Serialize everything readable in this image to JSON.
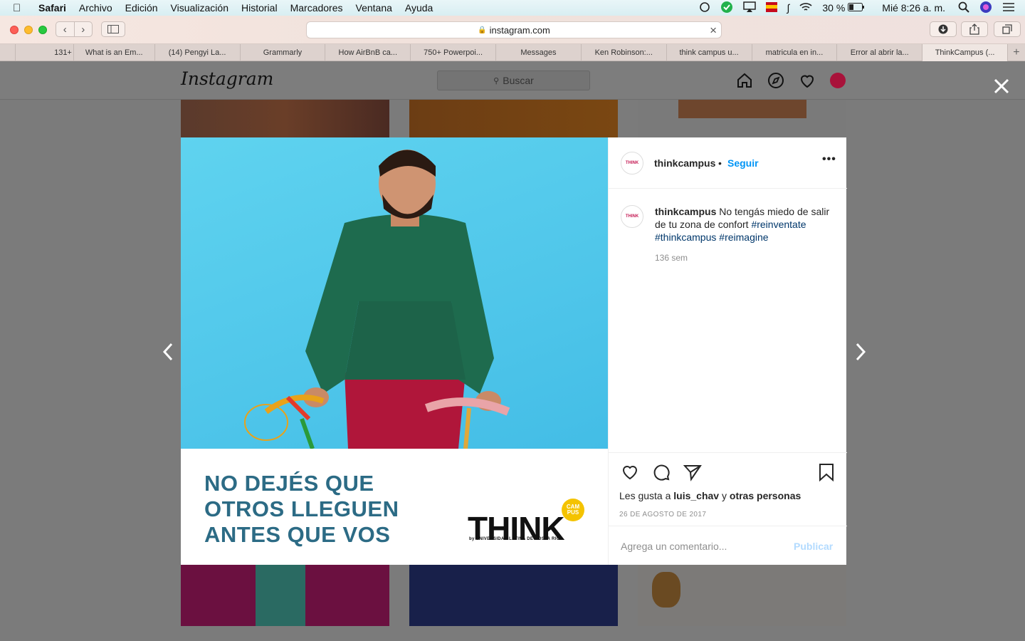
{
  "menubar": {
    "app": "Safari",
    "items": [
      "Archivo",
      "Edición",
      "Visualización",
      "Historial",
      "Marcadores",
      "Ventana",
      "Ayuda"
    ],
    "battery": "30 %",
    "clock": "Mié 8:26 a. m."
  },
  "browser": {
    "url": "instagram.com",
    "tabs": [
      "131+",
      "What is an Em...",
      "(14) Pengyi La...",
      "Grammarly",
      "How AirBnB ca...",
      "750+ Powerpoi...",
      "Messages",
      "Ken Robinson:...",
      "think campus u...",
      "matricula en in...",
      "Error al abrir la...",
      "ThinkCampus (..."
    ],
    "active_tab": 11
  },
  "instagram": {
    "logo": "Instagram",
    "search_placeholder": "Buscar",
    "post": {
      "image_text": {
        "slogan_line1": "NO DEJÉS QUE",
        "slogan_line2": "OTROS LLEGUEN",
        "slogan_line3": "ANTES QUE VOS",
        "brand": "THINK",
        "brand_badge": "CAM PUS",
        "brand_sub": "by UNIVERSIDAD LATINA DE COSTA RICA"
      },
      "username": "thinkcampus",
      "follow_label": "Seguir",
      "avatar_text": "THINK",
      "caption_user": "thinkcampus",
      "caption_text": "No tengás miedo de salir de tu zona de confort",
      "hashtags": [
        "#reinventate",
        "#thinkcampus",
        "#reimagine"
      ],
      "age": "136 sem",
      "likes_prefix": "Les gusta a",
      "likes_user": "luis_chav",
      "likes_join": "y",
      "likes_others": "otras personas",
      "date": "26 DE AGOSTO DE 2017",
      "comment_placeholder": "Agrega un comentario...",
      "publish_label": "Publicar"
    },
    "colors": {
      "link_blue": "#0095f6",
      "hashtag": "#00376b",
      "slogan": "#2c6b85",
      "photo_bg": "#4fc6ea"
    }
  }
}
